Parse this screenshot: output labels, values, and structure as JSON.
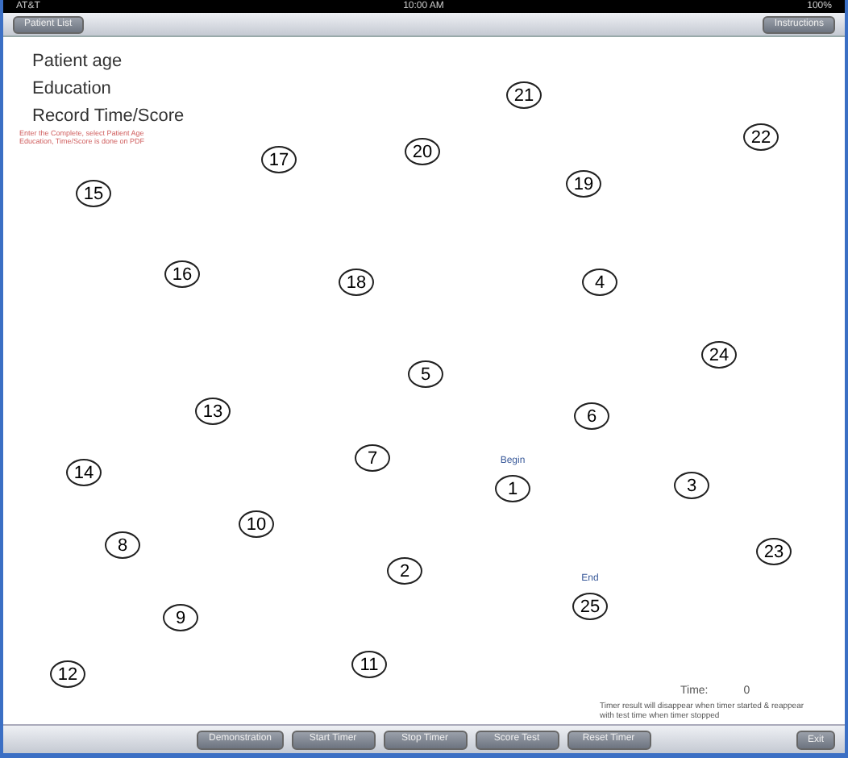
{
  "status_bar": {
    "carrier": "AT&T",
    "time": "10:00 AM",
    "battery": "100%"
  },
  "nav_bar": {
    "left_button": "Patient List",
    "right_button": "Instructions"
  },
  "fields": [
    {
      "label": "Patient age"
    },
    {
      "label": "Education"
    },
    {
      "label": "Record Time/Score"
    }
  ],
  "note": "Enter the Complete, select Patient Age Education, Time/Score is done on PDF",
  "nodes": [
    {
      "label": "21"
    },
    {
      "label": "22"
    },
    {
      "label": "20"
    },
    {
      "label": "17"
    },
    {
      "label": "19"
    },
    {
      "label": "15"
    },
    {
      "label": "16"
    },
    {
      "label": "18"
    },
    {
      "label": "4"
    },
    {
      "label": "24"
    },
    {
      "label": "5"
    },
    {
      "label": "13"
    },
    {
      "label": "6"
    },
    {
      "label": "7"
    },
    {
      "label": "14"
    },
    {
      "label": "1",
      "caption": "Begin"
    },
    {
      "label": "3"
    },
    {
      "label": "10"
    },
    {
      "label": "8"
    },
    {
      "label": "23"
    },
    {
      "label": "2"
    },
    {
      "label": "25",
      "caption": "End"
    },
    {
      "label": "9"
    },
    {
      "label": "12"
    },
    {
      "label": "11"
    }
  ],
  "timer": {
    "label": "Time:",
    "value": "0",
    "note": "Timer result will disappear when timer started & reappear with test time when timer stopped"
  },
  "toolbar": {
    "buttons": [
      "Demonstration",
      "Start Timer",
      "Stop Timer",
      "Score Test",
      "Reset Timer"
    ],
    "exit": "Exit"
  }
}
